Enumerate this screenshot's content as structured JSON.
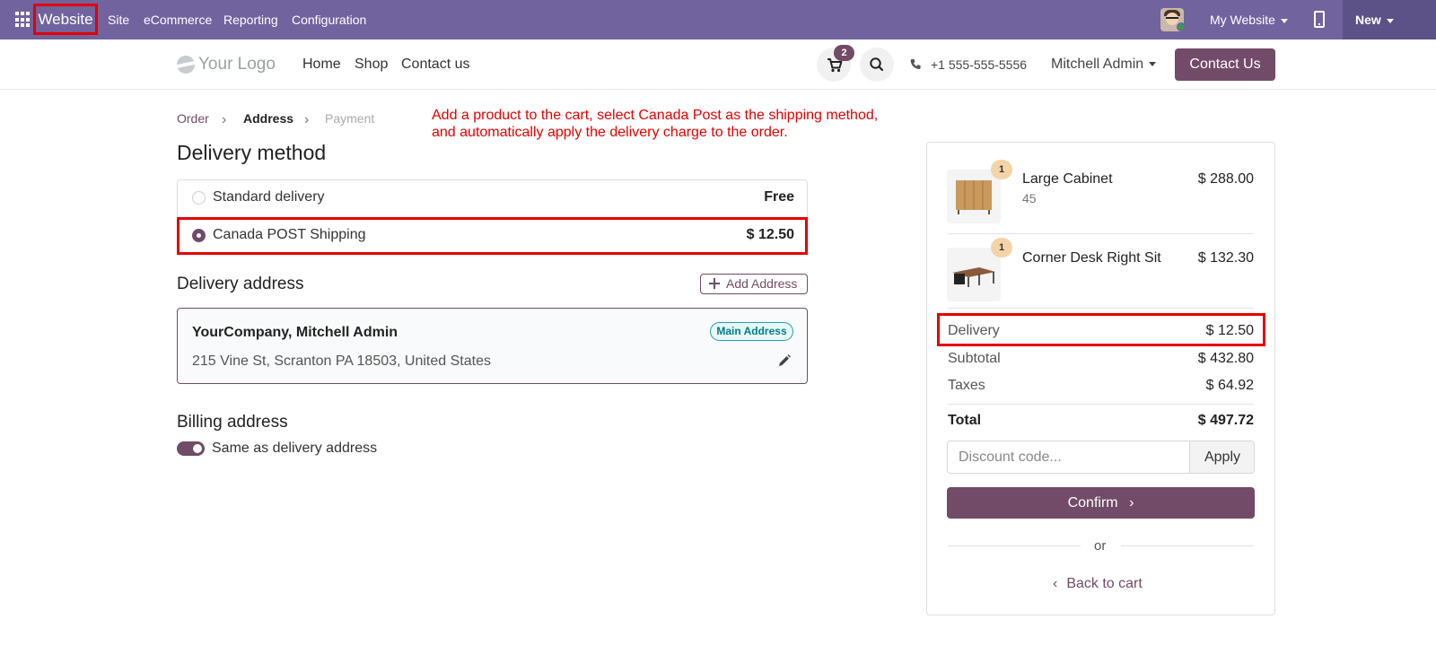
{
  "topbar": {
    "brand": "Website",
    "menu": [
      "Site",
      "eCommerce",
      "Reporting",
      "Configuration"
    ],
    "website_select": "My Website",
    "new_label": "New"
  },
  "header": {
    "logo_text": "Your Logo",
    "nav": [
      "Home",
      "Shop",
      "Contact us"
    ],
    "cart_count": "2",
    "phone": "+1 555-555-5556",
    "user": "Mitchell Admin",
    "contact_button": "Contact Us"
  },
  "breadcrumb": [
    "Order",
    "Address",
    "Payment"
  ],
  "annotation": {
    "line1": "Add a product to the cart, select Canada Post as the shipping method,",
    "line2": "and automatically apply the delivery charge to the order."
  },
  "delivery": {
    "title": "Delivery method",
    "methods": [
      {
        "label": "Standard delivery",
        "price": "Free",
        "selected": false
      },
      {
        "label": "Canada POST Shipping",
        "price": "$ 12.50",
        "selected": true
      }
    ]
  },
  "address": {
    "title": "Delivery address",
    "add_button": "Add Address",
    "name": "YourCompany, Mitchell Admin",
    "line": "215 Vine St, Scranton PA 18503, United States",
    "badge": "Main Address"
  },
  "billing": {
    "title": "Billing address",
    "toggle_label": "Same as delivery address",
    "toggle_on": true
  },
  "summary": {
    "items": [
      {
        "name": "Large Cabinet",
        "sub": "45",
        "price": "$ 288.00",
        "qty": "1"
      },
      {
        "name": "Corner Desk Right Sit",
        "sub": "",
        "price": "$ 132.30",
        "qty": "1"
      }
    ],
    "delivery_label": "Delivery",
    "delivery_value": "$ 12.50",
    "subtotal_label": "Subtotal",
    "subtotal_value": "$ 432.80",
    "taxes_label": "Taxes",
    "taxes_value": "$ 64.92",
    "total_label": "Total",
    "total_value": "$ 497.72",
    "discount_placeholder": "Discount code...",
    "apply_label": "Apply",
    "confirm_label": "Confirm",
    "or_label": "or",
    "back_label": "Back to cart"
  },
  "colors": {
    "topbar": "#71639e",
    "accent": "#714b67",
    "highlight": "#e30000",
    "badge": "#017e84"
  },
  "icons": [
    "apps-icon",
    "cart-icon",
    "search-icon",
    "phone-icon",
    "mobile-preview-icon",
    "plus-icon",
    "pencil-icon",
    "chevron-right-icon",
    "chevron-left-icon"
  ]
}
